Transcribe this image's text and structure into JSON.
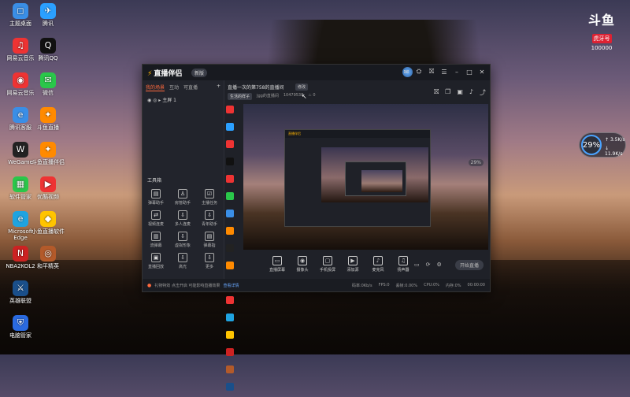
{
  "desktop": {
    "icons": [
      {
        "label": "主题桌面",
        "color": "#3a8ee6",
        "glyph": "◻"
      },
      {
        "label": "腾讯",
        "color": "#2ba0ff",
        "glyph": "✈"
      },
      {
        "label": "网易云音乐",
        "color": "#e33",
        "glyph": "♫"
      },
      {
        "label": "腾讯QQ",
        "color": "#111",
        "glyph": "Q"
      },
      {
        "label": "网易云音乐",
        "color": "#e33",
        "glyph": "◉"
      },
      {
        "label": "微信",
        "color": "#2ac74a",
        "glyph": "✉"
      },
      {
        "label": "腾讯客服",
        "color": "#3a8ee6",
        "glyph": "e"
      },
      {
        "label": "斗鱼直播",
        "color": "#ff8a00",
        "glyph": "✦"
      },
      {
        "label": "WeGame",
        "color": "#222",
        "glyph": "W"
      },
      {
        "label": "斗鱼直播伴侣",
        "color": "#ff8a00",
        "glyph": "✦"
      },
      {
        "label": "软件管家",
        "color": "#2ac74a",
        "glyph": "▦"
      },
      {
        "label": "优酷视频",
        "color": "#e33",
        "glyph": "▶"
      },
      {
        "label": "Microsoft Edge",
        "color": "#1fa3e0",
        "glyph": "e"
      },
      {
        "label": "小鱼直播软件",
        "color": "#ffc400",
        "glyph": "◆"
      },
      {
        "label": "NBA2KOL2",
        "color": "#c22",
        "glyph": "N"
      },
      {
        "label": "和平精英",
        "color": "#b35a2a",
        "glyph": "◎"
      },
      {
        "label": "英雄联盟",
        "color": "#1a4f8a",
        "glyph": "⚔"
      },
      {
        "label": "电脑管家",
        "color": "#2a6ae0",
        "glyph": "⛨"
      }
    ]
  },
  "brand": {
    "logo": "斗鱼",
    "tag": "虎牙号",
    "num": "100000"
  },
  "gauge": {
    "percent": "29%",
    "up": "3.5K/s",
    "down": "11.9K/s"
  },
  "app": {
    "title": "直播伴侣",
    "version": "新版",
    "titlebar_icons": [
      "message-icon",
      "shirt-icon",
      "gift-icon",
      "settings-icon",
      "minimize-icon",
      "maximize-icon",
      "close-icon"
    ],
    "tabs": [
      "我的场景",
      "互动",
      "可直播"
    ],
    "scene": "主屏 1",
    "tool_section": "工具箱",
    "tools": [
      {
        "label": "弹幕助手",
        "glyph": "▤"
      },
      {
        "label": "房管助手",
        "glyph": "♙"
      },
      {
        "label": "主播任务",
        "glyph": "☑"
      },
      {
        "label": "视频连麦",
        "glyph": "⇄"
      },
      {
        "label": "多人连麦",
        "glyph": "⇩"
      },
      {
        "label": "青年助手",
        "glyph": "⇩"
      },
      {
        "label": "流弹幕",
        "glyph": "▥"
      },
      {
        "label": "虚拟形象",
        "glyph": "⇩"
      },
      {
        "label": "弹幕指",
        "glyph": "▤"
      },
      {
        "label": "直播回放",
        "glyph": "▣"
      },
      {
        "label": "高光",
        "glyph": "⇩"
      },
      {
        "label": "更多",
        "glyph": "⇩"
      }
    ],
    "stream": {
      "title": "直播一次的第758的直播间",
      "edit_btn": "修改",
      "category": "生活的样子",
      "room": "Jgg的直播间",
      "id": "10479538",
      "fans": "0"
    },
    "header_icons": [
      "gift-icon",
      "layers-icon",
      "ticket-icon",
      "bell-icon",
      "share-icon"
    ],
    "controls": [
      {
        "label": "直播屏幕",
        "glyph": "▭"
      },
      {
        "label": "摄像头",
        "glyph": "◉"
      },
      {
        "label": "手机投屏",
        "glyph": "▢"
      },
      {
        "label": "添加源",
        "glyph": "▶"
      },
      {
        "label": "麦克风",
        "glyph": "♪"
      },
      {
        "label": "扬声器",
        "glyph": "♫"
      }
    ],
    "start_button": "开始直播",
    "notice": "礼物特效  点击开启 可能影响直播效果",
    "notice_link": "查看详情",
    "stats": [
      "码率:0Kb/s",
      "FPS:0",
      "丢帧:0.00%",
      "CPU:0%",
      "内存:0%"
    ],
    "time": "00:00:00",
    "inner_title": "直播伴侣",
    "side_tag": "29%"
  }
}
